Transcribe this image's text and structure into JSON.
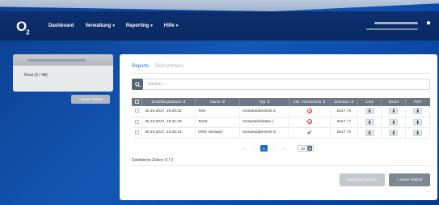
{
  "nav": {
    "logo_main": "O",
    "logo_sub": "2",
    "items": [
      {
        "label": "Dashboard",
        "caret": ""
      },
      {
        "label": "Verwaltung",
        "caret": "▾"
      },
      {
        "label": "Reporting",
        "caret": "▾"
      },
      {
        "label": "Hilfe",
        "caret": "▾"
      }
    ]
  },
  "sidebar": {
    "item_label": "Root (3 / 48)",
    "new_folder_button": "+ neuer Ordner"
  },
  "tabs": {
    "active": "Reports",
    "inactive": "Rufnummern"
  },
  "search": {
    "placeholder": "Suchen..."
  },
  "table": {
    "headers": [
      "Erstellungsdatum",
      "Name",
      "Typ",
      "inkl. Verzeichnis",
      "Zeitraum",
      "CSV",
      "Excel",
      "PDF"
    ],
    "rows": [
      {
        "date": "30.10.2017, 10:20:32",
        "name": "Test",
        "type": "Gesamtübersicht d",
        "incl": "no",
        "period": "2017 / 8"
      },
      {
        "date": "30.10.2017, 10:31:40",
        "name": "Test2",
        "type": "Gesprächsdaten (",
        "incl": "no",
        "period": "2017 / 7"
      },
      {
        "date": "30.10.2017, 13:40:13",
        "name": "GRG Versand",
        "type": "Gesamtübersicht G",
        "incl": "yes",
        "period": "2017 / 8"
      }
    ]
  },
  "pager": {
    "first": "«",
    "prev": "‹",
    "current": "1",
    "next": "›",
    "last": "»",
    "page_size": "10"
  },
  "selected_rows": "Selektierte Zeilen: 0 / 3",
  "buttons": {
    "delete_report": "Report(s) löschen",
    "new_report": "+ neuer Report"
  },
  "colors": {
    "accent": "#1b6fc0",
    "navbar": "#0d2f6e",
    "error": "#e03636"
  }
}
